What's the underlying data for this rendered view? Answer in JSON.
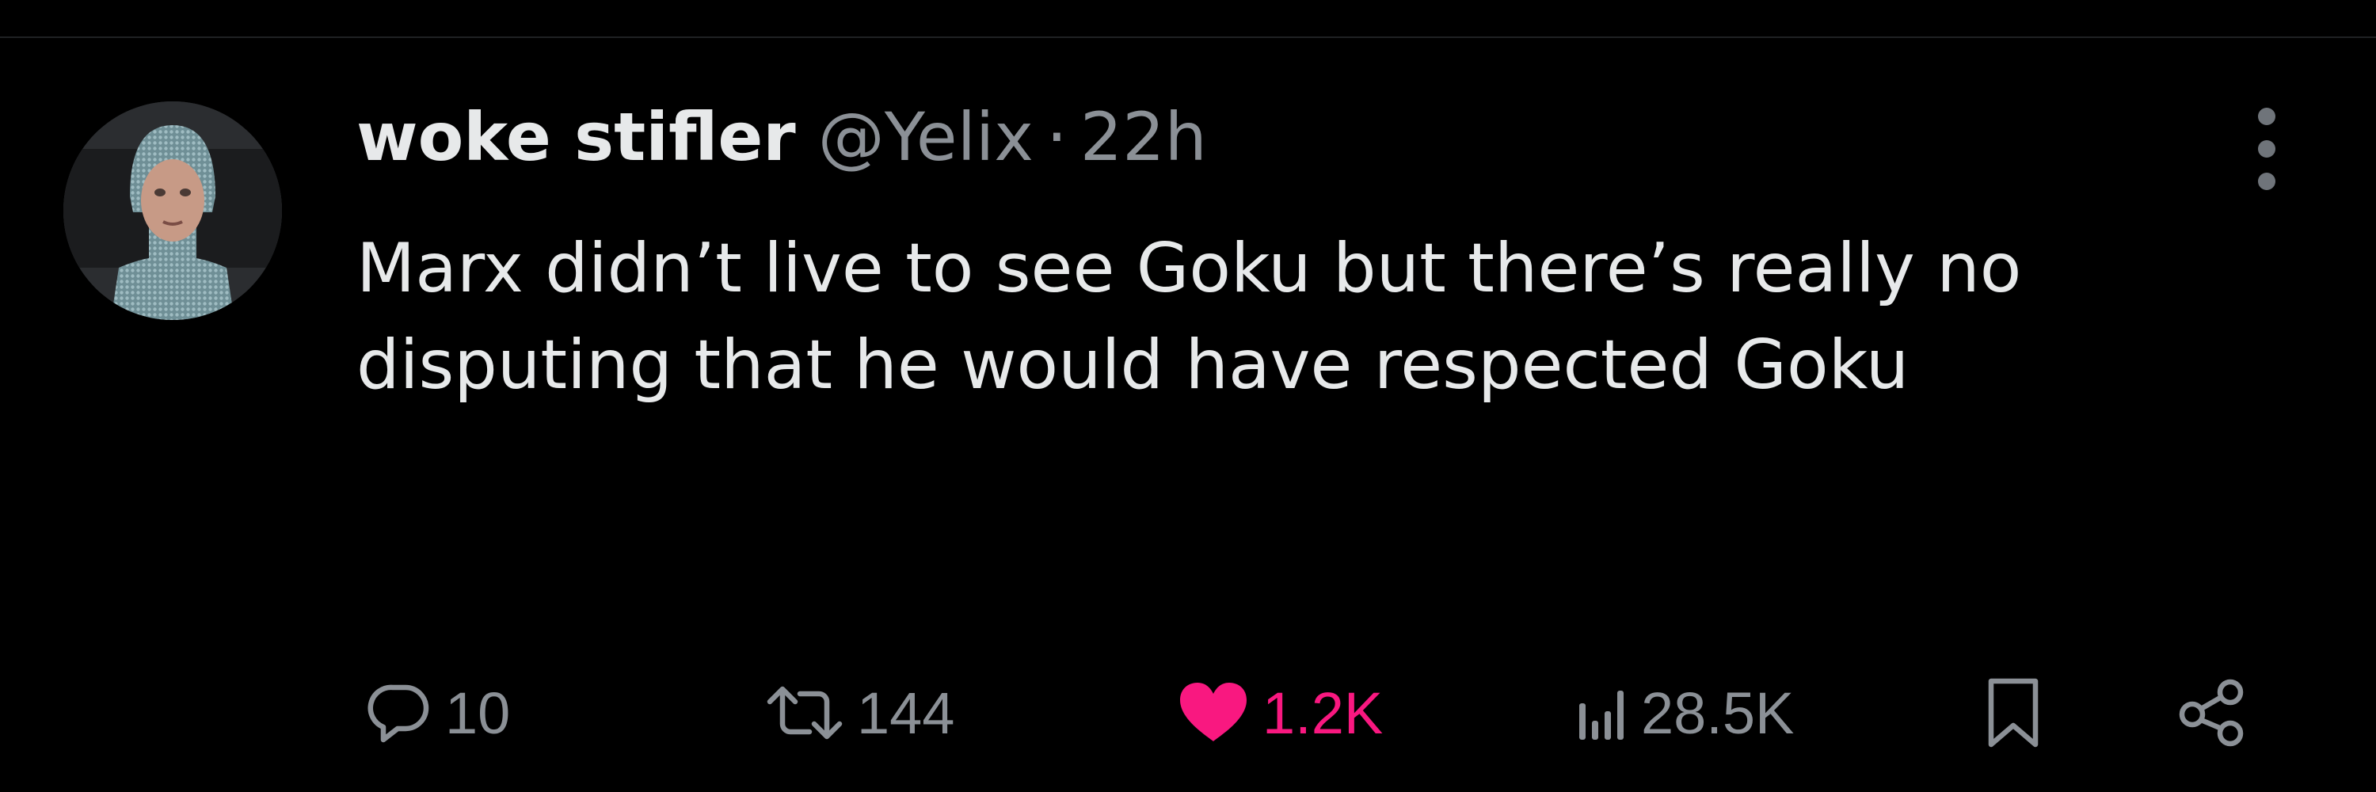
{
  "tweet": {
    "author": {
      "display_name": "woke stifler",
      "handle": "@Yelix"
    },
    "separator": "·",
    "time": "22h",
    "text": "Marx didn’t live to see Goku but there’s really no disputing that he would have respected Goku"
  },
  "actions": {
    "replies": "10",
    "retweets": "144",
    "likes": "1.2K",
    "views": "28.5K"
  },
  "colors": {
    "background": "#000000",
    "text": "#e7e9ea",
    "muted": "#8b9096",
    "like": "#f91880"
  },
  "icons": {
    "reply": "reply-icon",
    "retweet": "retweet-icon",
    "like": "heart-icon",
    "views": "views-icon",
    "bookmark": "bookmark-icon",
    "share": "share-icon",
    "more": "more-vertical-icon"
  }
}
